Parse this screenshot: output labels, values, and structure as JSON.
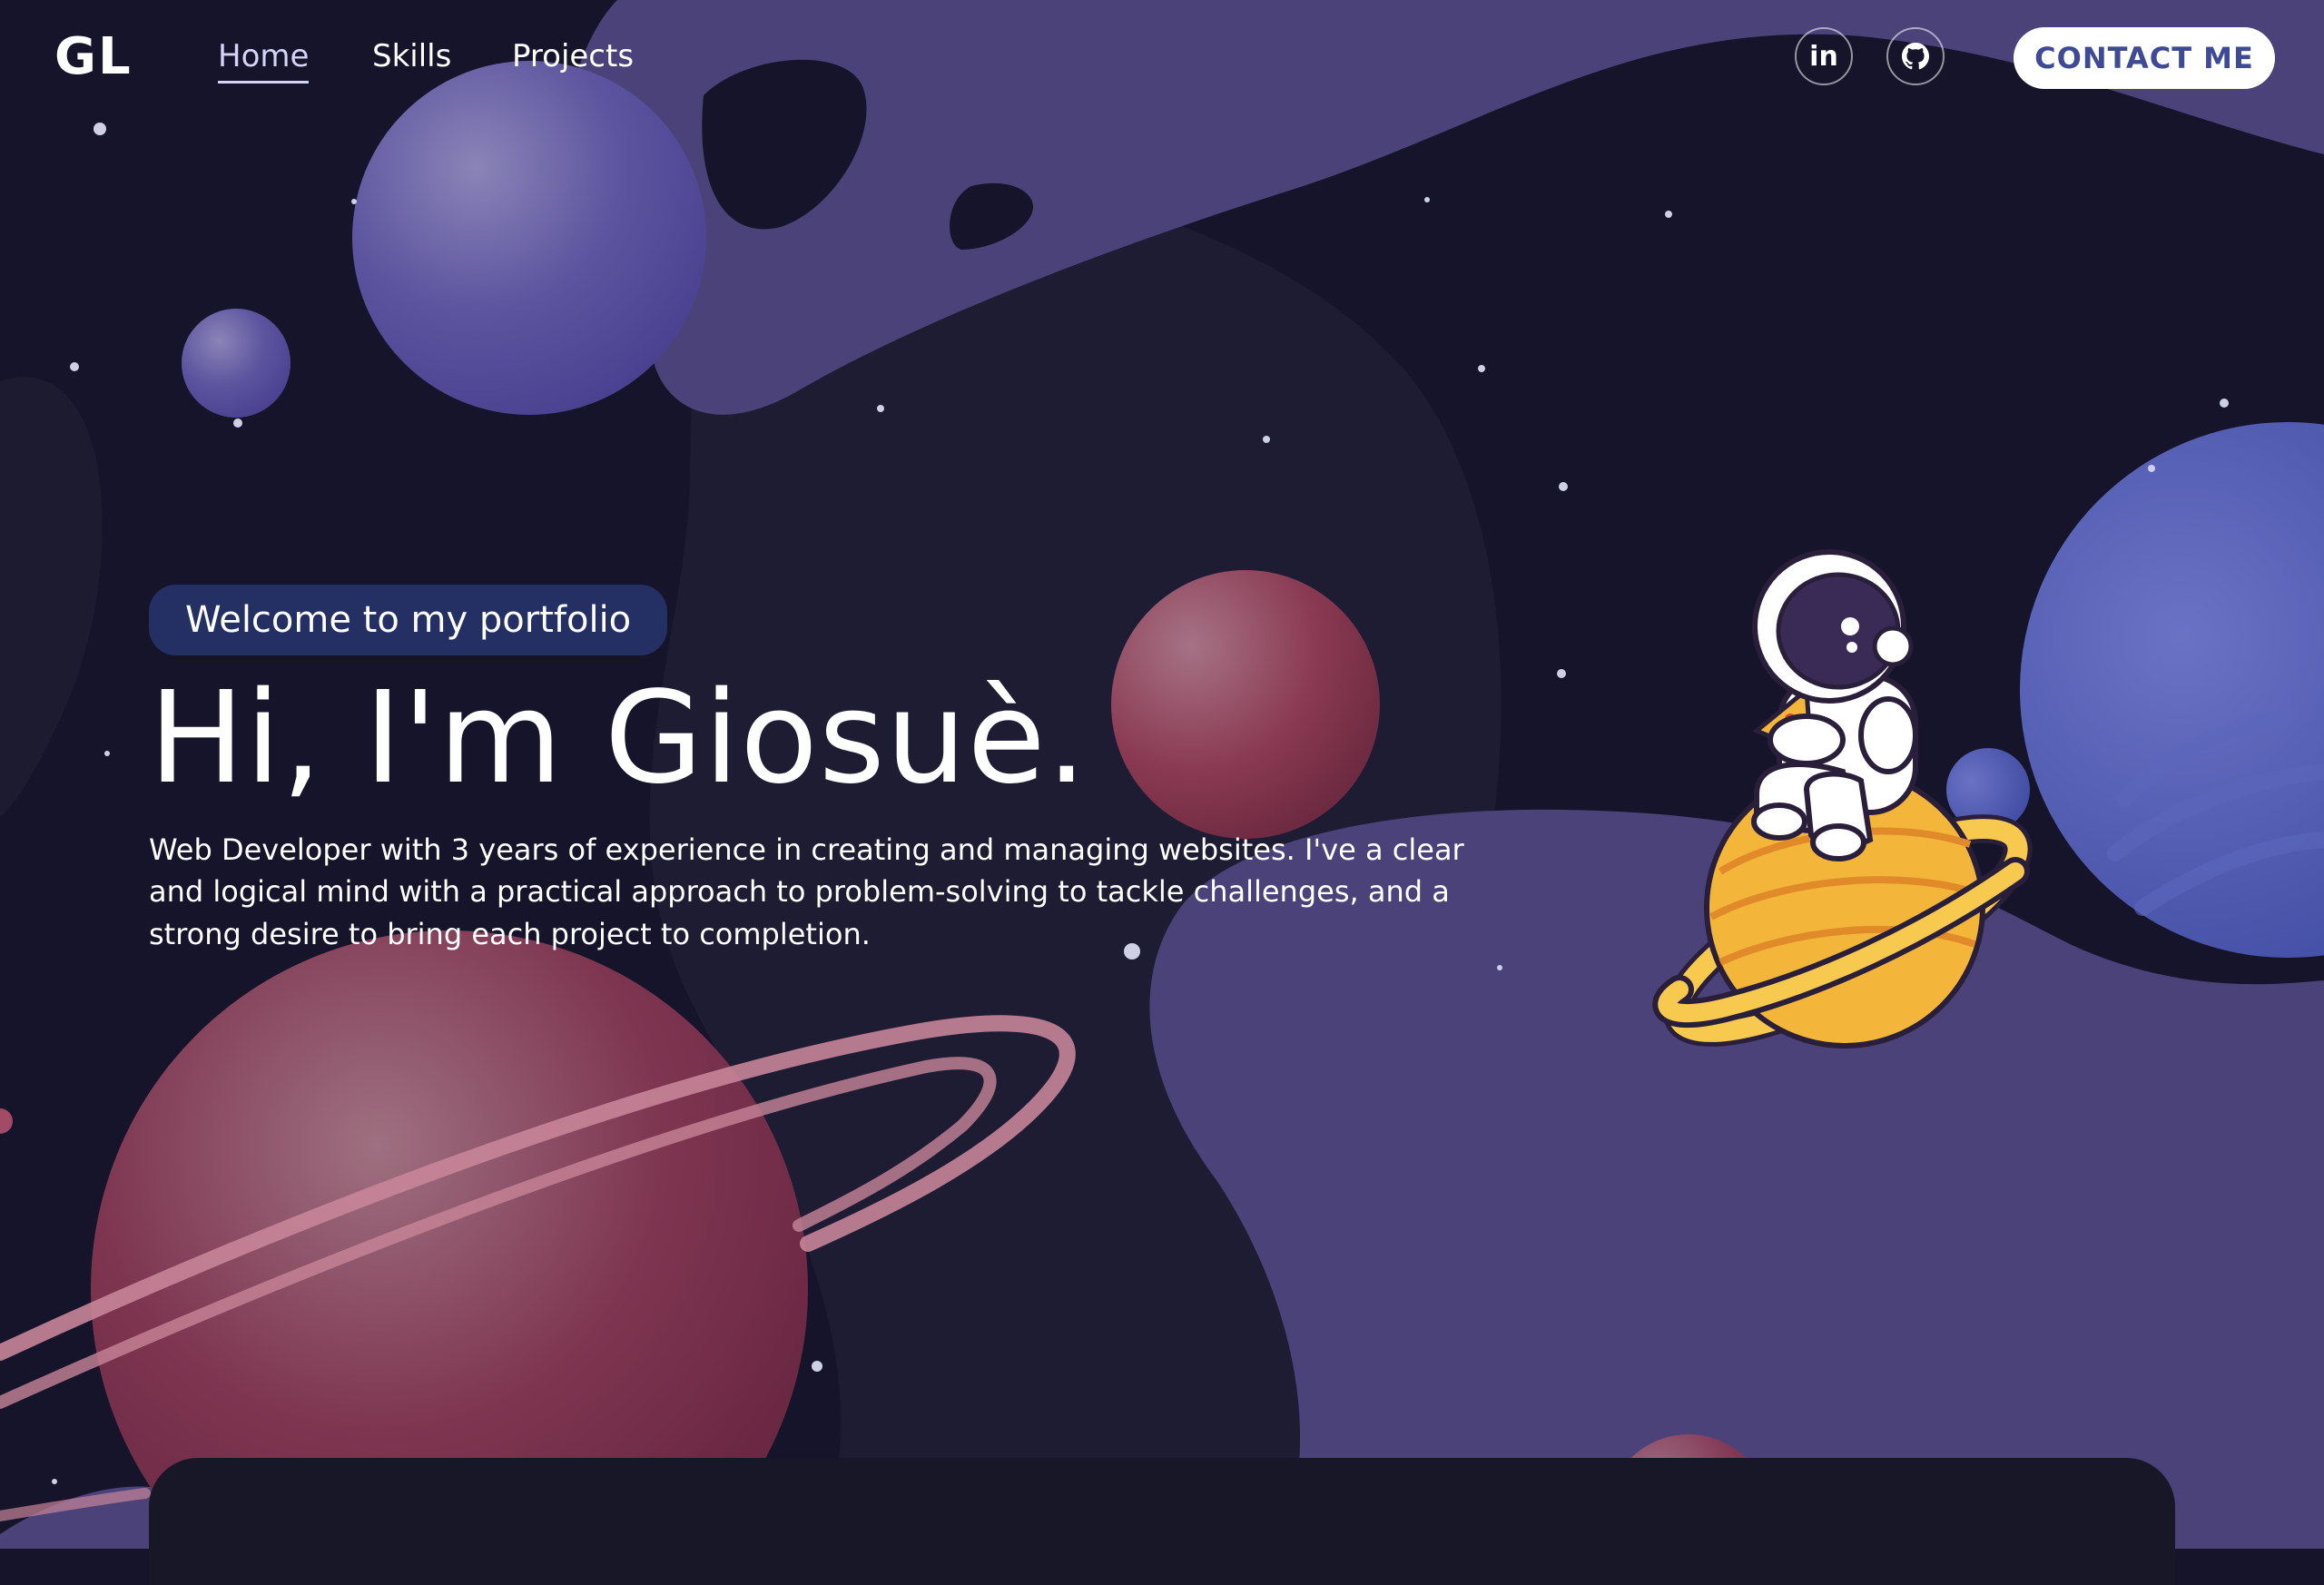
{
  "nav": {
    "logo": "GL",
    "links": [
      {
        "label": "Home",
        "active": true
      },
      {
        "label": "Skills",
        "active": false
      },
      {
        "label": "Projects",
        "active": false
      }
    ],
    "social": [
      {
        "icon": "linkedin-icon",
        "label": "in"
      },
      {
        "icon": "github-icon"
      }
    ],
    "contact_label": "CONTACT ME"
  },
  "hero": {
    "tagline": "Welcome to my portfolio",
    "headline": "Hi, I'm Giosuè.",
    "bio": "Web Developer with 3 years of experience in creating and managing websites. I've a clear and logical mind with a practical approach to problem-solving to tackle challenges, and a strong desire to bring each project to completion."
  },
  "colors": {
    "background": "#15142a",
    "nebula": "#4a4279",
    "accent": "#3e4a94",
    "planet_red": "#8a3a52",
    "planet_purple": "#5b53a3",
    "saturn": "#f4b63a"
  }
}
